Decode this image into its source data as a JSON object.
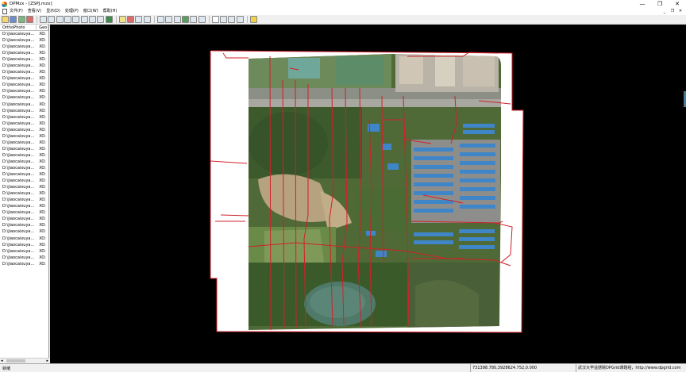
{
  "window": {
    "title": "DPMzx - [ZSPJ.mzx]",
    "controls": [
      "—",
      "❐",
      "✕"
    ]
  },
  "menu": {
    "items": [
      "文件(F)",
      "查看(V)",
      "显示(D)",
      "处理(P)",
      "窗口(W)",
      "帮助(H)"
    ],
    "mdi_controls": [
      "_",
      "❐",
      "✕"
    ]
  },
  "table": {
    "headers": [
      "OrthoPhoto",
      "Geo"
    ],
    "rows": [
      [
        "D:\\jiaocaixuya...",
        "XO:"
      ],
      [
        "D:\\jiaocaixuya...",
        "XO:"
      ],
      [
        "D:\\jiaocaixuya...",
        "XO:"
      ],
      [
        "D:\\jiaocaixuya...",
        "XO:"
      ],
      [
        "D:\\jiaocaixuya...",
        "XO:"
      ],
      [
        "D:\\jiaocaixuya...",
        "XO:"
      ],
      [
        "D:\\jiaocaixuya...",
        "XO:"
      ],
      [
        "D:\\jiaocaixuya...",
        "XO:"
      ],
      [
        "D:\\jiaocaixuya...",
        "XO:"
      ],
      [
        "D:\\jiaocaixuya...",
        "XO:"
      ],
      [
        "D:\\jiaocaixuya...",
        "XO:"
      ],
      [
        "D:\\jiaocaixuya...",
        "XO:"
      ],
      [
        "D:\\jiaocaixuya...",
        "XO:"
      ],
      [
        "D:\\jiaocaixuya...",
        "XO:"
      ],
      [
        "D:\\jiaocaixuya...",
        "XO:"
      ],
      [
        "D:\\jiaocaixuya...",
        "XO:"
      ],
      [
        "D:\\jiaocaixuya...",
        "XO:"
      ],
      [
        "D:\\jiaocaixuya...",
        "XO:"
      ],
      [
        "D:\\jiaocaixuya...",
        "XO:"
      ],
      [
        "D:\\jiaocaixuya...",
        "XO:"
      ],
      [
        "D:\\jiaocaixuya...",
        "XO:"
      ],
      [
        "D:\\jiaocaixuya...",
        "XO:"
      ],
      [
        "D:\\jiaocaixuya...",
        "XO:"
      ],
      [
        "D:\\jiaocaixuya...",
        "XO:"
      ],
      [
        "D:\\jiaocaixuya...",
        "XO:"
      ],
      [
        "D:\\jiaocaixuya...",
        "XO:"
      ],
      [
        "D:\\jiaocaixuya...",
        "XO:"
      ],
      [
        "D:\\jiaocaixuya...",
        "XO:"
      ],
      [
        "D:\\jiaocaixuya...",
        "XO:"
      ],
      [
        "D:\\jiaocaixuya...",
        "XO:"
      ],
      [
        "D:\\jiaocaixuya...",
        "XO:"
      ],
      [
        "D:\\jiaocaixuya...",
        "XO:"
      ],
      [
        "D:\\jiaocaixuya...",
        "XO:"
      ],
      [
        "D:\\jiaocaixuya...",
        "XO:"
      ],
      [
        "D:\\jiaocaixuya...",
        "XO:"
      ],
      [
        "D:\\jiaocaixuya...",
        "XO:"
      ],
      [
        "D:\\jiaocaixuya...",
        "XO:"
      ]
    ]
  },
  "status": {
    "ready": "就绪",
    "coords": "731398.780,3928624.752,0.000",
    "credit": "武汉大学遥感院DPGrid课题组，http://www.dpgrid.com"
  },
  "colors": {
    "seam": "#d2202a",
    "canvas": "#000000"
  }
}
